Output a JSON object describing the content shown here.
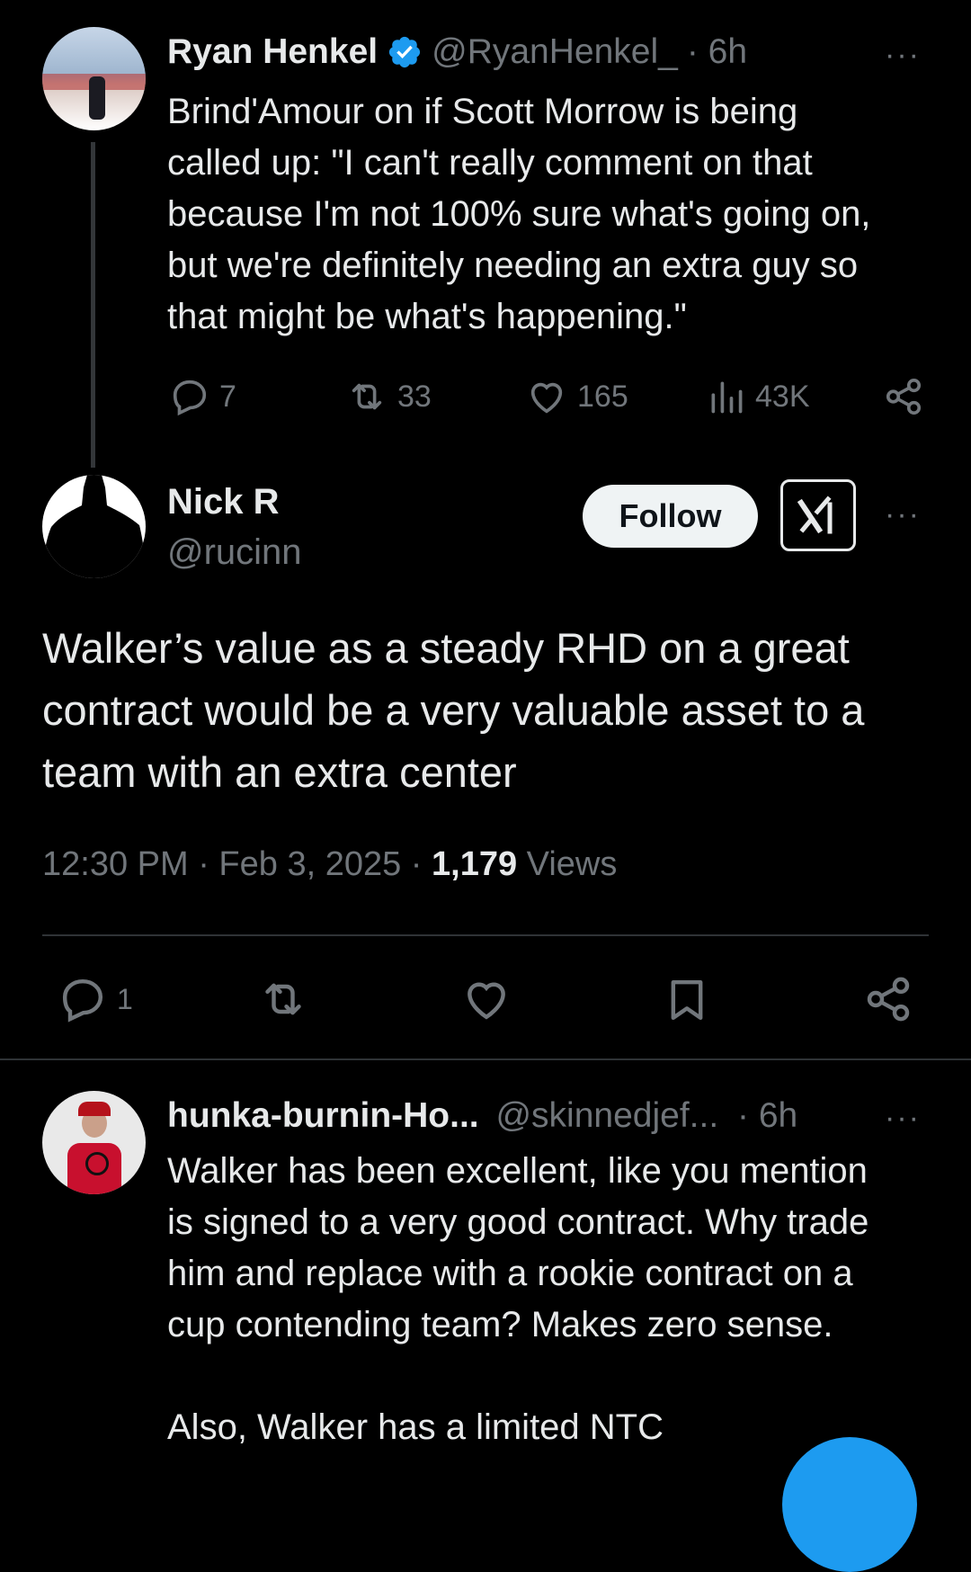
{
  "tweet1": {
    "name": "Ryan Henkel",
    "handle": "@RyanHenkel_",
    "time": "· 6h",
    "more": "···",
    "text_lines": [
      "Brind'Amour on if Scott Morrow is being",
      "called up: \"I can't really comment on that",
      "because I'm not 100% sure what's going on,",
      "but we're definitely needing an extra guy so",
      "that might be what's happening.\""
    ],
    "replies": "7",
    "reposts": "33",
    "likes": "165",
    "views": "43K"
  },
  "tweet2": {
    "name": "Nick R",
    "handle": "@rucinn",
    "follow_label": "Follow",
    "more": "···",
    "text_lines": [
      "Walker’s value as a steady RHD on a great",
      "contract would be a very valuable asset to a",
      "team with an extra center"
    ],
    "timestamp": "12:30 PM · Feb 3, 2025 · ",
    "view_count": "1,179",
    "views_label": " Views",
    "replies": "1"
  },
  "reply": {
    "name": "hunka-burnin-Ho...",
    "handle": "@skinnedjef...",
    "time": "· 6h",
    "more": "···",
    "text_lines": [
      "Walker has been excellent, like you mention",
      "is signed to a very good contract. Why trade",
      "him and replace with a rookie contract on a",
      "cup contending team? Makes zero sense."
    ],
    "text_line_extra": "Also, Walker has a limited NTC"
  },
  "colors": {
    "background": "#000000",
    "text": "#e7e9ea",
    "muted": "#71767b",
    "verified": "#1d9bf0",
    "divider": "#2f3336",
    "fab": "#1d9bf0"
  }
}
